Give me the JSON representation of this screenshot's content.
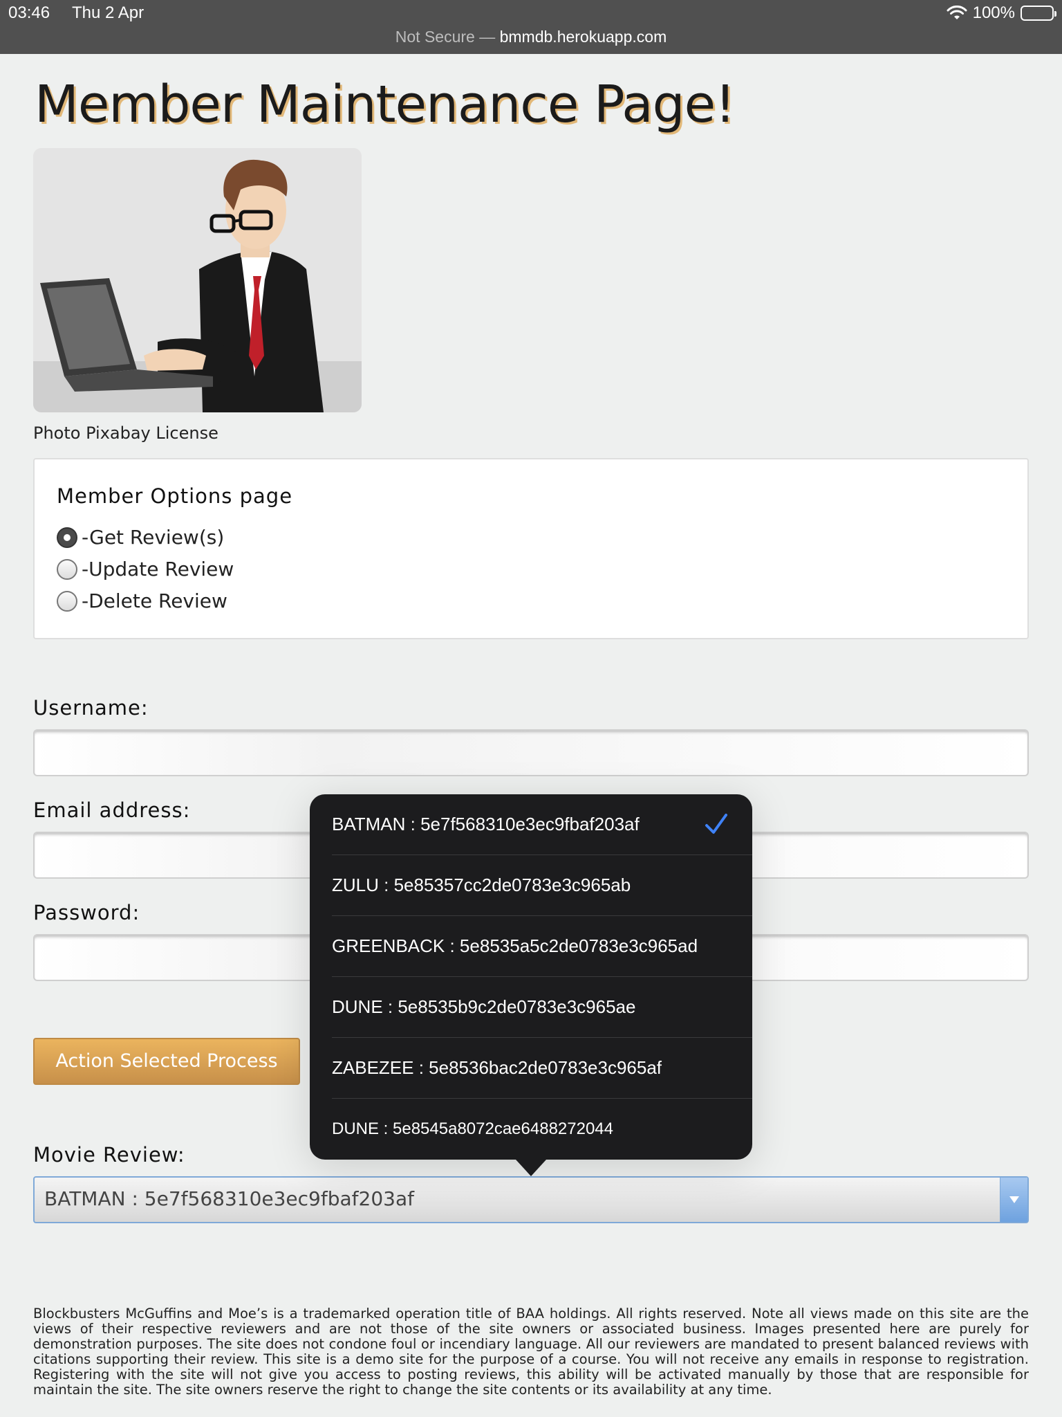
{
  "status_bar": {
    "time": "03:46",
    "date": "Thu 2 Apr",
    "battery": "100%",
    "icons": [
      "wifi-icon",
      "battery-icon"
    ]
  },
  "address_bar": {
    "security": "Not Secure —",
    "domain": "bmmdb.herokuapp.com"
  },
  "page": {
    "title": "Member Maintenance Page!",
    "photo_caption": "Photo Pixabay License"
  },
  "options": {
    "heading": "Member Options page",
    "items": [
      {
        "label": "-Get Review(s)",
        "checked": true
      },
      {
        "label": "-Update Review",
        "checked": false
      },
      {
        "label": "-Delete Review",
        "checked": false
      }
    ]
  },
  "form": {
    "username_label": "Username:",
    "email_label": "Email address:",
    "password_label": "Password:",
    "username_value": "",
    "email_value": "",
    "password_value": "",
    "action_button": "Action Selected Process",
    "movie_review_label": "Movie Review:",
    "movie_review_selected": "BATMAN : 5e7f568310e3ec9fbaf203af"
  },
  "dropdown": {
    "options": [
      {
        "label": "BATMAN : 5e7f568310e3ec9fbaf203af",
        "selected": true
      },
      {
        "label": "ZULU : 5e85357cc2de0783e3c965ab",
        "selected": false
      },
      {
        "label": "GREENBACK : 5e8535a5c2de0783e3c965ad",
        "selected": false
      },
      {
        "label": "DUNE : 5e8535b9c2de0783e3c965ae",
        "selected": false
      },
      {
        "label": "ZABEZEE : 5e8536bac2de0783e3c965af",
        "selected": false
      },
      {
        "label": "DUNE : 5e8545a8072cae6488272044",
        "selected": false
      }
    ]
  },
  "footer": {
    "text": "Blockbusters McGuffins and Moe’s is a trademarked operation title of BAA holdings. All rights reserved. Note all views made on this site are the views of their respective reviewers and are not those of the site owners or associated business. Images presented here are purely for demonstration purposes. The site does not condone foul or incendiary language. All our reviewers are mandated to present balanced reviews with citations supporting their review. This site is a demo site for the purpose of a course. You will not receive any emails in response to registration. Registering with the site will not give you access to posting reviews, this ability will be activated manually by those that are responsible for maintain the site. The site owners reserve the right to change the site contents or its availability at any time."
  },
  "colors": {
    "accent": "#e8b05c",
    "title_shadow": "#e2b878",
    "popover_bg": "#1c1c1e",
    "check": "#3f82f7",
    "select_border": "#7fa9d8"
  }
}
